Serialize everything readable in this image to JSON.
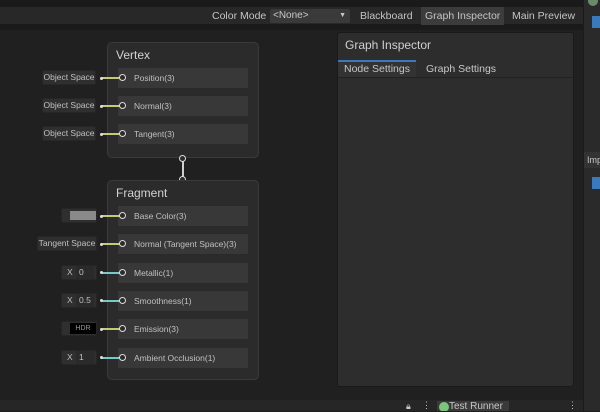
{
  "toolbar": {
    "color_mode_label": "Color Mode",
    "color_mode_value": "<None>",
    "blackboard": "Blackboard",
    "graph_inspector": "Graph Inspector",
    "main_preview": "Main Preview"
  },
  "vertex": {
    "title": "Vertex",
    "slots": [
      {
        "label": "Position(3)",
        "input": "Object Space"
      },
      {
        "label": "Normal(3)",
        "input": "Object Space"
      },
      {
        "label": "Tangent(3)",
        "input": "Object Space"
      }
    ]
  },
  "fragment": {
    "title": "Fragment",
    "slots": [
      {
        "label": "Base Color(3)",
        "type": "color",
        "color": "#8a8a8a"
      },
      {
        "label": "Normal (Tangent Space)(3)",
        "type": "text",
        "input": "Tangent Space"
      },
      {
        "label": "Metallic(1)",
        "type": "float",
        "axis": "X",
        "value": "0"
      },
      {
        "label": "Smoothness(1)",
        "type": "float",
        "axis": "X",
        "value": "0.5"
      },
      {
        "label": "Emission(3)",
        "type": "hdr",
        "input": "HDR"
      },
      {
        "label": "Ambient Occlusion(1)",
        "type": "float",
        "axis": "X",
        "value": "1"
      }
    ]
  },
  "inspector": {
    "title": "Graph Inspector",
    "tabs": [
      "Node Settings",
      "Graph Settings"
    ]
  },
  "bottom": {
    "tab": "Test Runner"
  },
  "right_panel": {
    "label": "Imp"
  },
  "colors": {
    "vec3_wire": "#c8c87a",
    "float_wire": "#7ac8c8",
    "accent": "#3a79bb"
  }
}
